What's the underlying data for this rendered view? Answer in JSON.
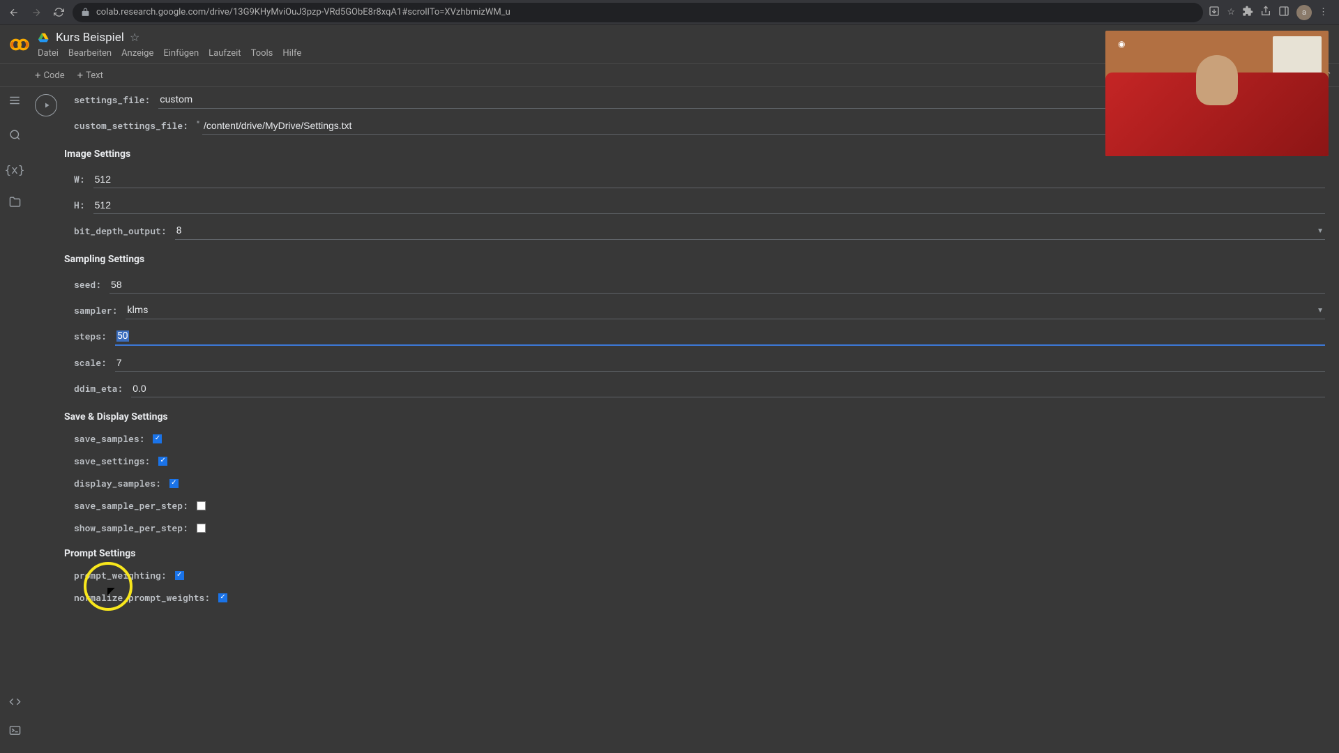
{
  "chrome": {
    "url": "colab.research.google.com/drive/13G9KHyMviOuJ3pzp-VRd5GObE8r8xqA1#scrollTo=XVzhbmizWM_u"
  },
  "header": {
    "title": "Kurs Beispiel",
    "menus": [
      "Datei",
      "Bearbeiten",
      "Anzeige",
      "Einfügen",
      "Laufzeit",
      "Tools",
      "Hilfe"
    ]
  },
  "toolbar": {
    "code": "Code",
    "text": "Text"
  },
  "form": {
    "settings_file": {
      "label": "settings_file",
      "value": "custom"
    },
    "custom_settings_file": {
      "label": "custom_settings_file",
      "prefix": "\" ",
      "value": "/content/drive/MyDrive/Settings.txt"
    },
    "sections": {
      "image": "Image Settings",
      "sampling": "Sampling Settings",
      "save_display": "Save & Display Settings",
      "prompt": "Prompt Settings"
    },
    "W": {
      "label": "W",
      "value": "512"
    },
    "H": {
      "label": "H",
      "value": "512"
    },
    "bit_depth_output": {
      "label": "bit_depth_output",
      "value": "8"
    },
    "seed": {
      "label": "seed",
      "value": "58"
    },
    "sampler": {
      "label": "sampler",
      "value": "klms"
    },
    "steps": {
      "label": "steps",
      "value": "50"
    },
    "scale": {
      "label": "scale",
      "value": "7"
    },
    "ddim_eta": {
      "label": "ddim_eta",
      "value": "0.0"
    },
    "save_samples": {
      "label": "save_samples",
      "checked": true
    },
    "save_settings": {
      "label": "save_settings",
      "checked": true
    },
    "display_samples": {
      "label": "display_samples",
      "checked": true
    },
    "save_sample_per_step": {
      "label": "save_sample_per_step",
      "checked": false
    },
    "show_sample_per_step": {
      "label": "show_sample_per_step",
      "checked": false
    },
    "prompt_weighting": {
      "label": "prompt_weighting",
      "checked": true
    },
    "normalize_prompt_weights": {
      "label": "normalize_prompt_weights",
      "checked": true
    }
  }
}
